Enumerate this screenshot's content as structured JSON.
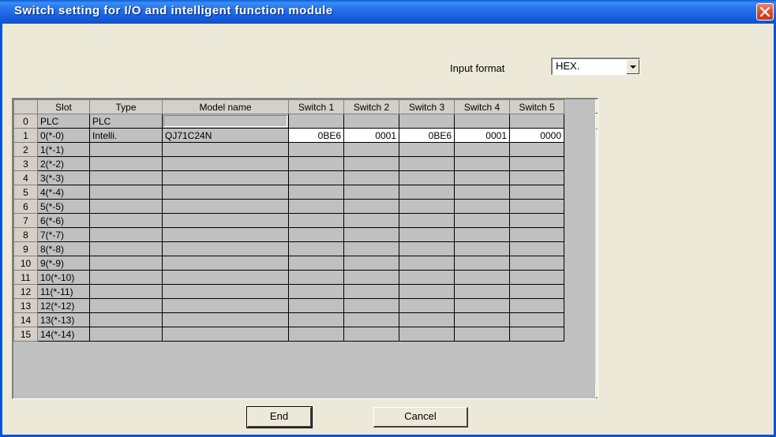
{
  "window": {
    "title": "Switch setting for I/O and intelligent function module"
  },
  "input_format": {
    "label": "Input format",
    "value": "HEX."
  },
  "table": {
    "headers": [
      "",
      "Slot",
      "Type",
      "Model name",
      "Switch 1",
      "Switch 2",
      "Switch 3",
      "Switch 4",
      "Switch 5"
    ],
    "rows": [
      {
        "num": "0",
        "slot": "PLC",
        "type": "PLC",
        "model": "",
        "switches": [
          "",
          "",
          "",
          "",
          ""
        ]
      },
      {
        "num": "1",
        "slot": "0(*-0)",
        "type": "Intelli.",
        "model": "QJ71C24N",
        "switches": [
          "0BE6",
          "0001",
          "0BE6",
          "0001",
          "0000"
        ]
      },
      {
        "num": "2",
        "slot": "1(*-1)",
        "type": "",
        "model": "",
        "switches": [
          "",
          "",
          "",
          "",
          ""
        ]
      },
      {
        "num": "3",
        "slot": "2(*-2)",
        "type": "",
        "model": "",
        "switches": [
          "",
          "",
          "",
          "",
          ""
        ]
      },
      {
        "num": "4",
        "slot": "3(*-3)",
        "type": "",
        "model": "",
        "switches": [
          "",
          "",
          "",
          "",
          ""
        ]
      },
      {
        "num": "5",
        "slot": "4(*-4)",
        "type": "",
        "model": "",
        "switches": [
          "",
          "",
          "",
          "",
          ""
        ]
      },
      {
        "num": "6",
        "slot": "5(*-5)",
        "type": "",
        "model": "",
        "switches": [
          "",
          "",
          "",
          "",
          ""
        ]
      },
      {
        "num": "7",
        "slot": "6(*-6)",
        "type": "",
        "model": "",
        "switches": [
          "",
          "",
          "",
          "",
          ""
        ]
      },
      {
        "num": "8",
        "slot": "7(*-7)",
        "type": "",
        "model": "",
        "switches": [
          "",
          "",
          "",
          "",
          ""
        ]
      },
      {
        "num": "9",
        "slot": "8(*-8)",
        "type": "",
        "model": "",
        "switches": [
          "",
          "",
          "",
          "",
          ""
        ]
      },
      {
        "num": "10",
        "slot": "9(*-9)",
        "type": "",
        "model": "",
        "switches": [
          "",
          "",
          "",
          "",
          ""
        ]
      },
      {
        "num": "11",
        "slot": "10(*-10)",
        "type": "",
        "model": "",
        "switches": [
          "",
          "",
          "",
          "",
          ""
        ]
      },
      {
        "num": "12",
        "slot": "11(*-11)",
        "type": "",
        "model": "",
        "switches": [
          "",
          "",
          "",
          "",
          ""
        ]
      },
      {
        "num": "13",
        "slot": "12(*-12)",
        "type": "",
        "model": "",
        "switches": [
          "",
          "",
          "",
          "",
          ""
        ]
      },
      {
        "num": "14",
        "slot": "13(*-13)",
        "type": "",
        "model": "",
        "switches": [
          "",
          "",
          "",
          "",
          ""
        ]
      },
      {
        "num": "15",
        "slot": "14(*-14)",
        "type": "",
        "model": "",
        "switches": [
          "",
          "",
          "",
          "",
          ""
        ]
      }
    ]
  },
  "buttons": {
    "end": "End",
    "cancel": "Cancel"
  },
  "icons": {
    "close": "close-icon",
    "dropdown": "chevron-down-icon",
    "scroll_up": "scroll-up-icon",
    "scroll_down": "scroll-down-icon"
  }
}
